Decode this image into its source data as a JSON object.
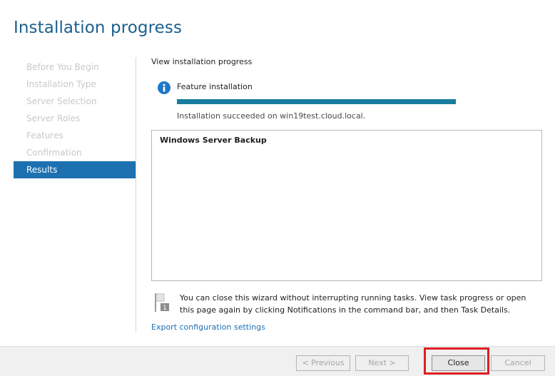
{
  "header": {
    "title": "Installation progress"
  },
  "nav": {
    "items": [
      {
        "label": "Before You Begin"
      },
      {
        "label": "Installation Type"
      },
      {
        "label": "Server Selection"
      },
      {
        "label": "Server Roles"
      },
      {
        "label": "Features"
      },
      {
        "label": "Confirmation"
      },
      {
        "label": "Results",
        "active": true
      }
    ]
  },
  "main": {
    "section_title": "View installation progress",
    "feature_label": "Feature installation",
    "progress": {
      "value_percent": 100,
      "color": "#187c9e"
    },
    "status_text": "Installation succeeded on win19test.cloud.local.",
    "results_items": [
      "Windows Server Backup"
    ],
    "notice_text": "You can close this wizard without interrupting running tasks. View task progress or open this page again by clicking Notifications in the command bar, and then Task Details.",
    "export_link": "Export configuration settings"
  },
  "footer": {
    "previous_label": "< Previous",
    "next_label": "Next >",
    "close_label": "Close",
    "cancel_label": "Cancel"
  },
  "colors": {
    "title": "#1c5f8e",
    "nav_active": "#1d71b0",
    "link": "#1d6fb5",
    "highlight": "#e01d24",
    "info_icon": "#1d78c8"
  },
  "icons": {
    "info": "info-icon",
    "notice": "flag-icon"
  }
}
